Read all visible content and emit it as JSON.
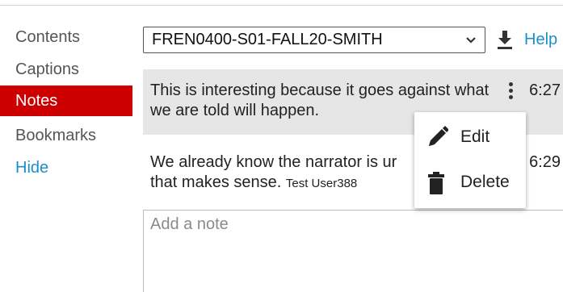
{
  "sidebar": {
    "items": [
      {
        "label": "Contents"
      },
      {
        "label": "Captions"
      },
      {
        "label": "Notes"
      },
      {
        "label": "Bookmarks"
      },
      {
        "label": "Hide"
      }
    ]
  },
  "header": {
    "course_select_value": "FREN0400-S01-FALL20-SMITH",
    "help_label": "Help"
  },
  "notes": [
    {
      "text": "This is interesting because it goes against what we are told will happen.",
      "user": "",
      "time": "6:27"
    },
    {
      "text": "We already know the narrator is ur",
      "text_after": "that makes sense.",
      "user": "Test User388",
      "time": "6:29"
    }
  ],
  "note_input": {
    "placeholder": "Add a note"
  },
  "context_menu": {
    "edit_label": "Edit",
    "delete_label": "Delete"
  },
  "colors": {
    "active_tab": "#cc0000",
    "link": "#1a8fc9",
    "selected_note_bg": "#e6e6e6"
  }
}
